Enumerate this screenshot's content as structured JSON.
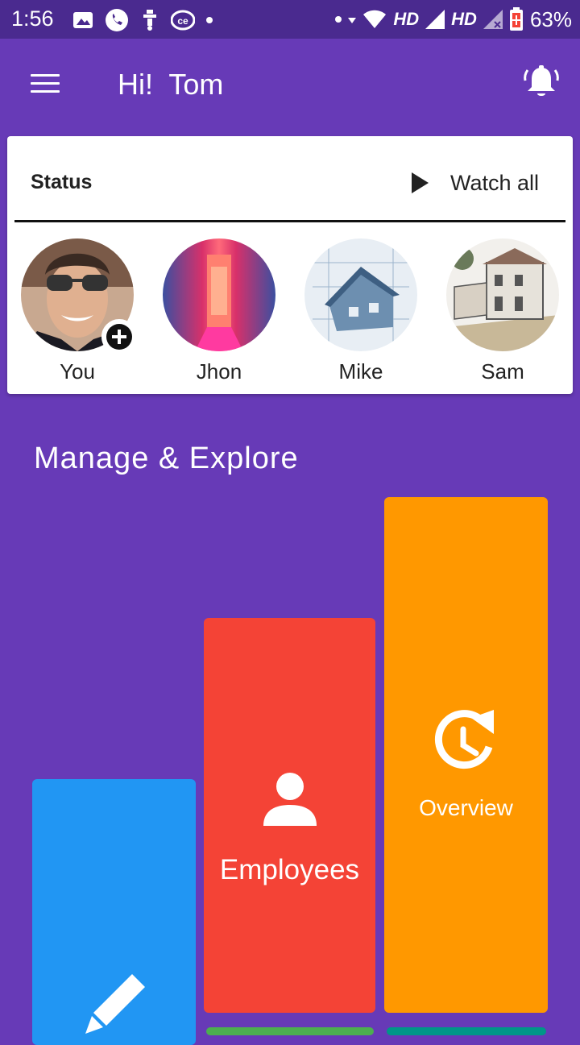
{
  "statusbar": {
    "time": "1:56",
    "network_1": "HD",
    "network_2": "HD",
    "battery": "63%"
  },
  "header": {
    "greeting": "Hi!  Tom",
    "menu_icon": "hamburger-menu-icon",
    "notification_icon": "bell-icon"
  },
  "status": {
    "title": "Status",
    "watch_all": "Watch all",
    "stories": [
      {
        "name": "You",
        "add_icon": "plus-icon"
      },
      {
        "name": "Jhon"
      },
      {
        "name": "Mike"
      },
      {
        "name": "Sam"
      }
    ]
  },
  "manage": {
    "title": "Manage & Explore",
    "tiles": [
      {
        "label": "",
        "icon": "pencil-icon",
        "color": "#2196f3"
      },
      {
        "label": "Employees",
        "icon": "person-icon",
        "color": "#f44336"
      },
      {
        "label": "Overview",
        "icon": "clock-refresh-icon",
        "color": "#ff9800"
      }
    ]
  },
  "colors": {
    "background": "#673ab7",
    "statusbar": "#4a2a8f"
  }
}
